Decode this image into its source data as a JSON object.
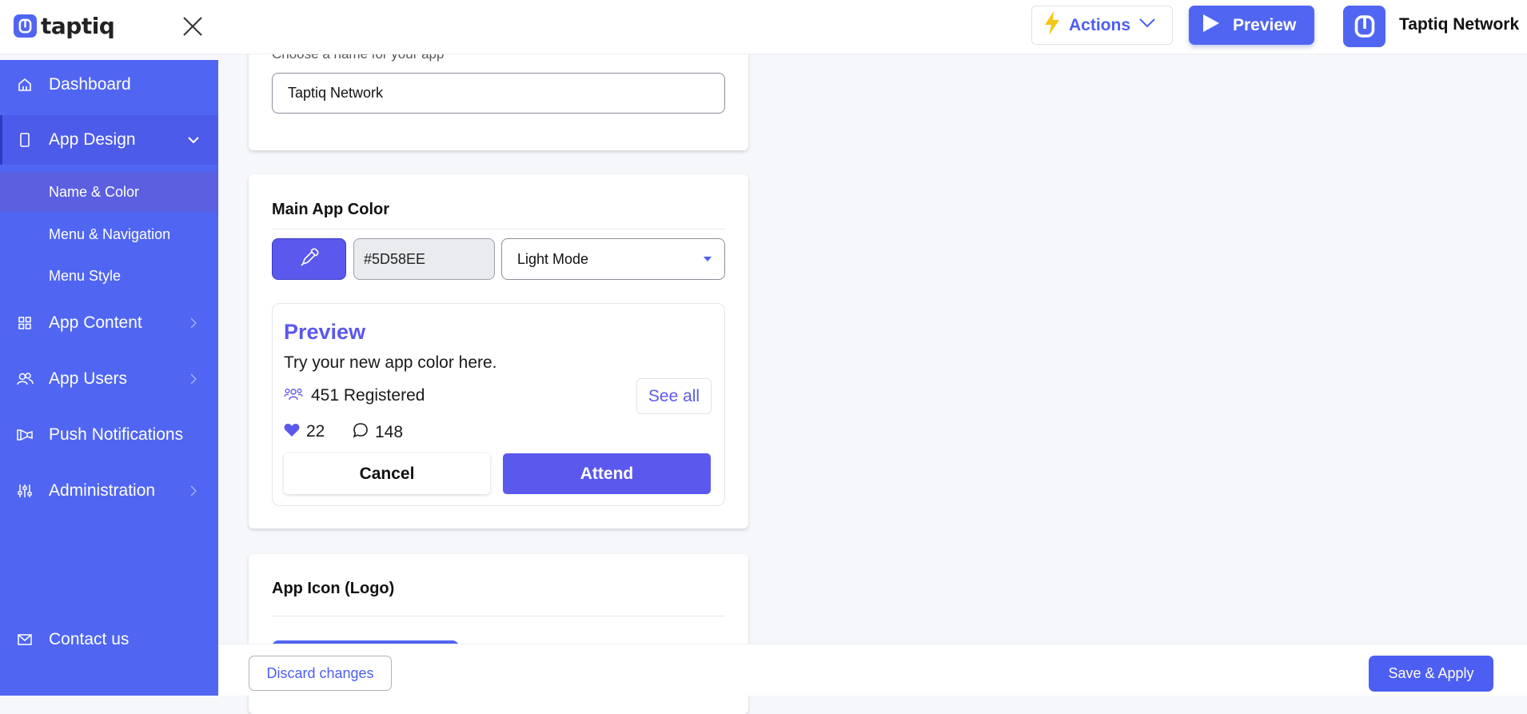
{
  "brand": {
    "name": "taptiq"
  },
  "header": {
    "actions_label": "Actions",
    "preview_label": "Preview",
    "app_name": "Taptiq Network"
  },
  "sidebar": {
    "items": [
      {
        "label": "Dashboard",
        "icon": "home-icon"
      },
      {
        "label": "App Design",
        "icon": "phone-icon"
      },
      {
        "label": "App Content",
        "icon": "grid-icon"
      },
      {
        "label": "App Users",
        "icon": "users-icon"
      },
      {
        "label": "Push Notifications",
        "icon": "megaphone-icon"
      },
      {
        "label": "Administration",
        "icon": "sliders-icon"
      }
    ],
    "subitems": [
      {
        "label": "Name & Color"
      },
      {
        "label": "Menu & Navigation"
      },
      {
        "label": "Menu Style"
      }
    ],
    "contact_label": "Contact us"
  },
  "name_card": {
    "hint": "Choose a name for your app",
    "value": "Taptiq Network"
  },
  "color_card": {
    "title": "Main App Color",
    "hex_value": "#5D58EE",
    "mode": "Light Mode",
    "preview": {
      "title": "Preview",
      "subtitle": "Try your new app color here.",
      "registered": "451 Registered",
      "see_all": "See all",
      "likes": "22",
      "comments": "148",
      "cancel": "Cancel",
      "attend": "Attend"
    }
  },
  "icon_card": {
    "title": "App Icon (Logo)"
  },
  "footer": {
    "discard_label": "Discard changes",
    "save_label": "Save & Apply"
  },
  "colors": {
    "sidebar": "#5066F2",
    "accent": "#5D58EE"
  }
}
